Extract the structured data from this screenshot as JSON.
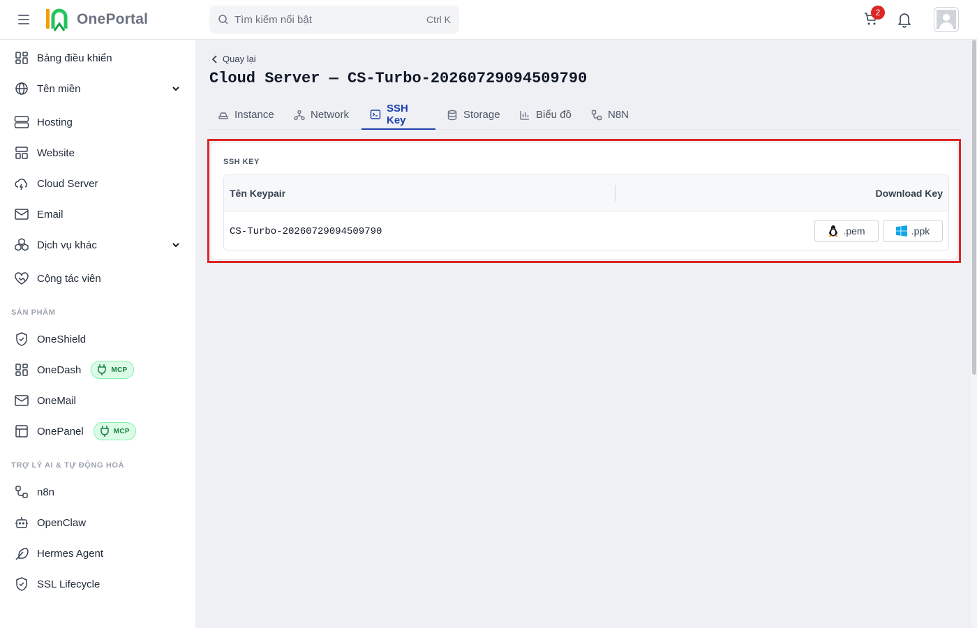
{
  "app": {
    "logo_text": "OnePortal"
  },
  "search": {
    "placeholder": "Tìm kiếm nổi bật",
    "shortcut": "Ctrl K"
  },
  "cart": {
    "count": "2"
  },
  "sidebar": {
    "items": [
      {
        "label": "Bảng điều khiển",
        "icon": "dashboard-icon"
      },
      {
        "label": "Tên miền",
        "icon": "globe-icon",
        "expandable": true
      },
      {
        "label": "Hosting",
        "icon": "server-icon"
      },
      {
        "label": "Website",
        "icon": "layout-icon"
      },
      {
        "label": "Cloud Server",
        "icon": "cloud-icon"
      },
      {
        "label": "Email",
        "icon": "mail-icon"
      },
      {
        "label": "Dịch vụ khác",
        "icon": "boxes-icon",
        "expandable": true
      },
      {
        "label": "Cộng tác viên",
        "icon": "handshake-icon"
      }
    ],
    "section_products": "SẢN PHẨM",
    "products": [
      {
        "label": "OneShield",
        "icon": "shield-icon"
      },
      {
        "label": "OneDash",
        "icon": "dashboard-icon",
        "badge": "MCP"
      },
      {
        "label": "OneMail",
        "icon": "mail-icon"
      },
      {
        "label": "OnePanel",
        "icon": "panel-icon",
        "badge": "MCP"
      }
    ],
    "section_ai": "TRỢ LÝ AI & TỰ ĐỘNG HOÁ",
    "ai": [
      {
        "label": "n8n",
        "icon": "workflow-icon"
      },
      {
        "label": "OpenClaw",
        "icon": "bot-icon"
      },
      {
        "label": "Hermes Agent",
        "icon": "feather-icon"
      },
      {
        "label": "SSL Lifecycle",
        "icon": "shield-check-icon"
      }
    ]
  },
  "main": {
    "back_label": "Quay lại",
    "title": "Cloud Server — CS-Turbo-20260729094509790",
    "tabs": [
      {
        "label": "Instance",
        "icon": "instance-icon"
      },
      {
        "label": "Network",
        "icon": "network-icon"
      },
      {
        "label": "SSH Key",
        "icon": "terminal-icon",
        "active": true
      },
      {
        "label": "Storage",
        "icon": "database-icon"
      },
      {
        "label": "Biểu đồ",
        "icon": "bar-chart-icon"
      },
      {
        "label": "N8N",
        "icon": "workflow-icon"
      }
    ],
    "panel": {
      "title": "SSH KEY",
      "columns": {
        "name": "Tên Keypair",
        "download": "Download Key"
      },
      "rows": [
        {
          "name": "CS-Turbo-20260729094509790",
          "pem_label": ".pem",
          "ppk_label": ".ppk"
        }
      ]
    }
  },
  "colors": {
    "accent": "#1e40af",
    "highlight_border": "#dc2626",
    "badge": "#dc2626",
    "mcp_bg": "#dcfce7",
    "mcp_text": "#15803d"
  }
}
